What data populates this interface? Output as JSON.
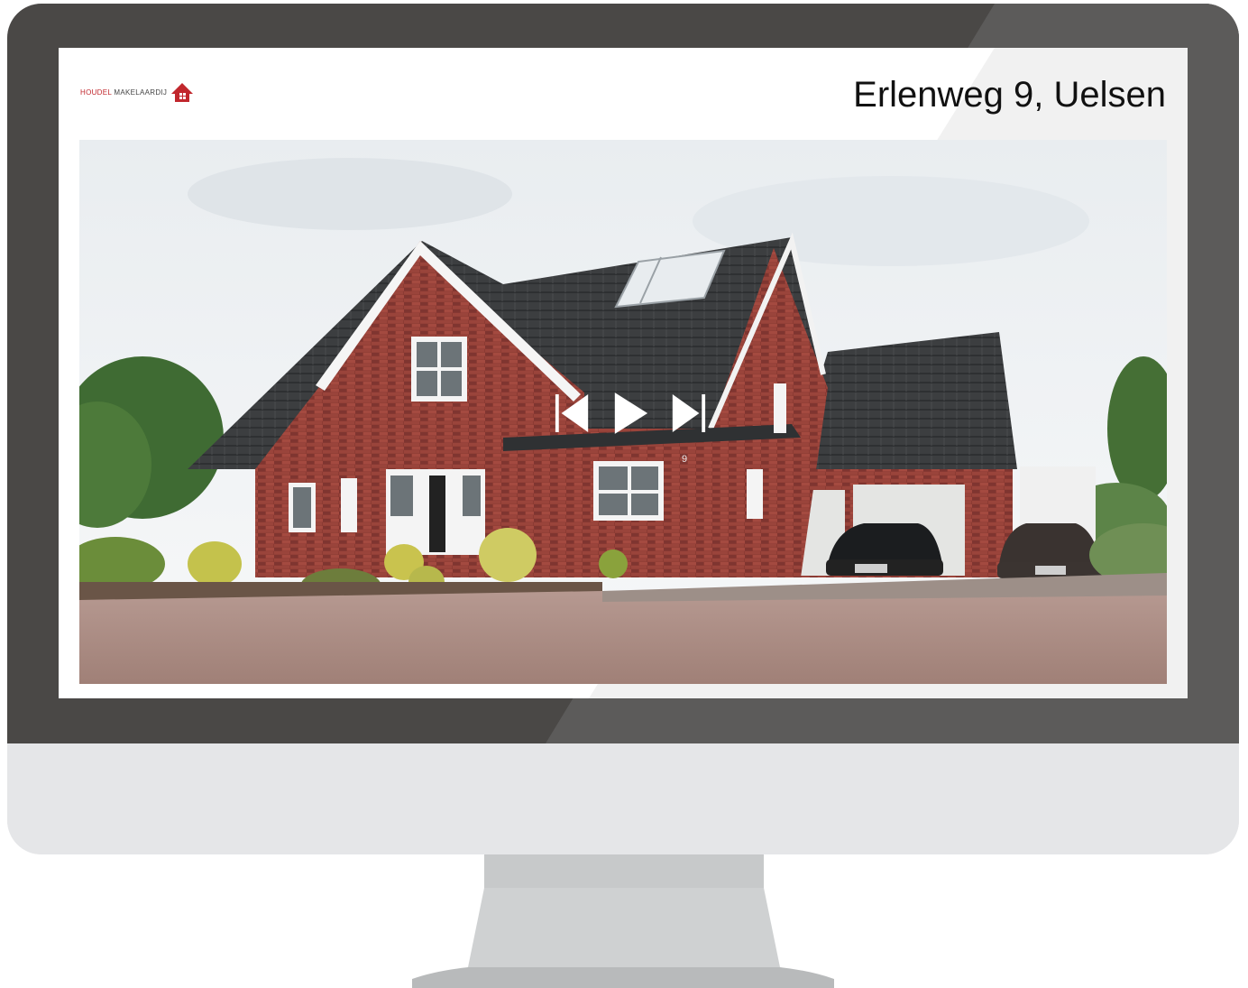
{
  "header": {
    "logo_red": "HOUDEL",
    "logo_rest": " MAKELAARDIJ",
    "title": "Erlenweg 9, Uelsen"
  },
  "photo": {
    "house_number": "9"
  },
  "player": {
    "previous_icon": "skip-previous-icon",
    "play_icon": "play-icon",
    "next_icon": "skip-next-icon"
  },
  "colors": {
    "bezel": "#4a4846",
    "chin": "#e5e6e8",
    "stand": "#c9cbcc",
    "brand_red": "#c1272d"
  }
}
